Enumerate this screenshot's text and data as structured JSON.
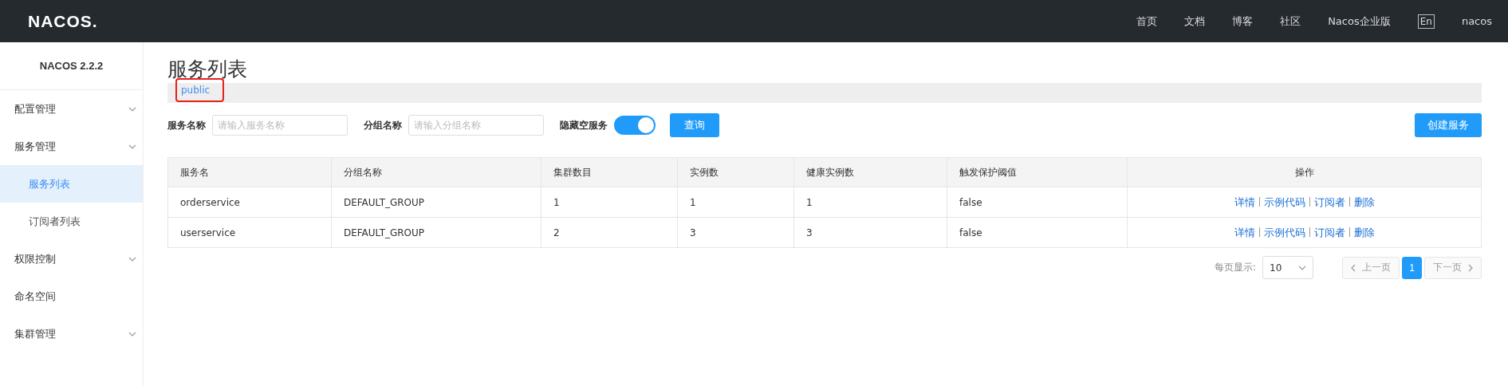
{
  "header": {
    "logo": "NACOS.",
    "nav": [
      "首页",
      "文档",
      "博客",
      "社区",
      "Nacos企业版"
    ],
    "language": "En",
    "user": "nacos"
  },
  "sidebar": {
    "title": "NACOS 2.2.2",
    "items": [
      {
        "label": "配置管理",
        "kind": "group"
      },
      {
        "label": "服务管理",
        "kind": "group",
        "children": [
          {
            "label": "服务列表",
            "selected": true
          },
          {
            "label": "订阅者列表",
            "selected": false
          }
        ]
      },
      {
        "label": "权限控制",
        "kind": "group"
      },
      {
        "label": "命名空间",
        "kind": "item"
      },
      {
        "label": "集群管理",
        "kind": "group"
      }
    ]
  },
  "page_title": "服务列表",
  "namespaces": [
    {
      "label": "public",
      "selected": true,
      "highlighted": true
    }
  ],
  "filters": {
    "fields": [
      {
        "label": "服务名称",
        "placeholder": "请输入服务名称"
      },
      {
        "label": "分组名称",
        "placeholder": "请输入分组名称"
      }
    ],
    "toggle": {
      "label": "隐藏空服务",
      "on": true
    },
    "query_button": "查询"
  },
  "create_button": "创建服务",
  "table": {
    "columns": [
      "服务名",
      "分组名称",
      "集群数目",
      "实例数",
      "健康实例数",
      "触发保护阈值",
      "操作"
    ],
    "rows": [
      {
        "cells": [
          "orderservice",
          "DEFAULT_GROUP",
          "1",
          "1",
          "1",
          "false"
        ],
        "actions": [
          "详情",
          "示例代码",
          "订阅者",
          "删除"
        ]
      },
      {
        "cells": [
          "userservice",
          "DEFAULT_GROUP",
          "2",
          "3",
          "3",
          "false"
        ],
        "actions": [
          "详情",
          "示例代码",
          "订阅者",
          "删除"
        ]
      }
    ]
  },
  "pagination": {
    "page_size_label": "每页显示:",
    "page_size": "10",
    "prev": {
      "label": "上一页",
      "disabled": true
    },
    "pages": [
      {
        "label": "1",
        "selected": true
      }
    ],
    "next": {
      "label": "下一页",
      "disabled": true
    }
  }
}
